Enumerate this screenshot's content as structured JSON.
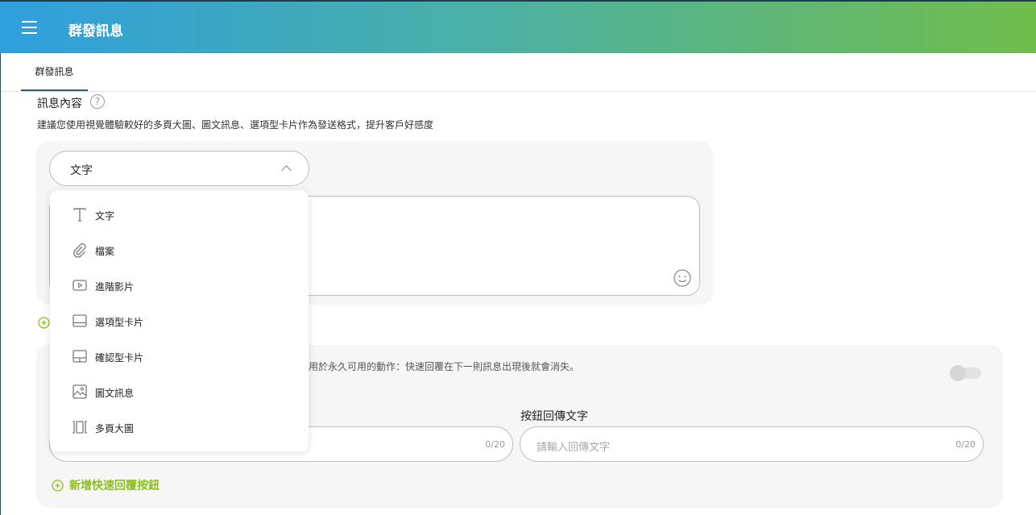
{
  "header": {
    "title": "群發訊息",
    "menu_icon": "hamburger-icon"
  },
  "tabs": [
    {
      "label": "群發訊息",
      "active": true
    }
  ],
  "message_section": {
    "title": "訊息內容",
    "hint": "建議您使用視覺體驗較好的多頁大圖、圖文訊息、選項型卡片作為發送格式，提升客戶好感度",
    "type_select_value": "文字"
  },
  "type_dropdown": {
    "items": [
      {
        "label": "文字",
        "icon": "text-icon"
      },
      {
        "label": "檔案",
        "icon": "paperclip-icon"
      },
      {
        "label": "進階影片",
        "icon": "video-play-icon"
      },
      {
        "label": "選項型卡片",
        "icon": "option-card-icon"
      },
      {
        "label": "確認型卡片",
        "icon": "confirm-card-icon"
      },
      {
        "label": "圖文訊息",
        "icon": "image-icon"
      },
      {
        "label": "多頁大圖",
        "icon": "carousel-icon"
      }
    ]
  },
  "quick_reply": {
    "description": "用於永久可用的動作：快速回覆在下一則訊息出現後就會消失。",
    "enabled": false,
    "reply_text_label": "按鈕回傳文字",
    "left_counter": "0/20",
    "right_placeholder": "請輸入回傳文字",
    "right_counter": "0/20",
    "add_button_label": "新增快速回覆按鈕"
  },
  "colors": {
    "accent_green": "#8cbf1f",
    "header_start": "#2f9fde",
    "header_end": "#71bd4c"
  }
}
